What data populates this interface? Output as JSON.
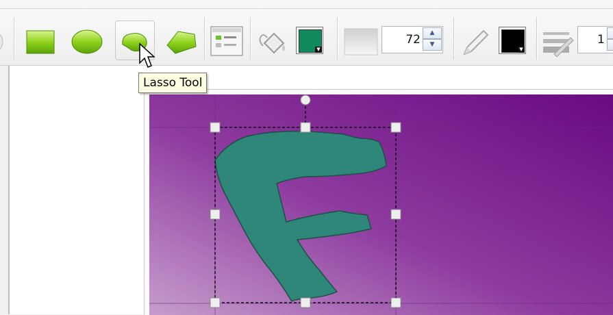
{
  "window": {
    "title": ""
  },
  "toolbar": {
    "tools": [
      {
        "id": "rectangle",
        "icon": "rectangle-icon",
        "label": "Rectangle Tool"
      },
      {
        "id": "ellipse",
        "icon": "ellipse-icon",
        "label": "Ellipse Tool"
      },
      {
        "id": "lasso",
        "icon": "lasso-icon",
        "label": "Lasso Tool",
        "hovered": true
      },
      {
        "id": "polygon",
        "icon": "polygon-icon",
        "label": "Polygon Tool"
      }
    ],
    "properties_icon": "properties-panel-icon",
    "fill_icon": "paint-bucket-icon",
    "fill_color": "#138a5b",
    "opacity_icon": "opacity-gradient-icon",
    "opacity_value": "72",
    "stroke_icon": "pencil-icon",
    "stroke_color": "#000000",
    "line_width_icon": "line-width-icon",
    "line_width_value": "1"
  },
  "tooltip": {
    "text": "Lasso Tool"
  },
  "canvas": {
    "background_gradient": [
      "#c79ccd",
      "#8d3a9e",
      "#6a0a82"
    ],
    "shape": {
      "letter_shape": "F",
      "fill": "#2e8778",
      "stroke": "#1d4f46"
    },
    "selection": {
      "style": "dashed",
      "handle_color": "#eeeeee"
    }
  }
}
